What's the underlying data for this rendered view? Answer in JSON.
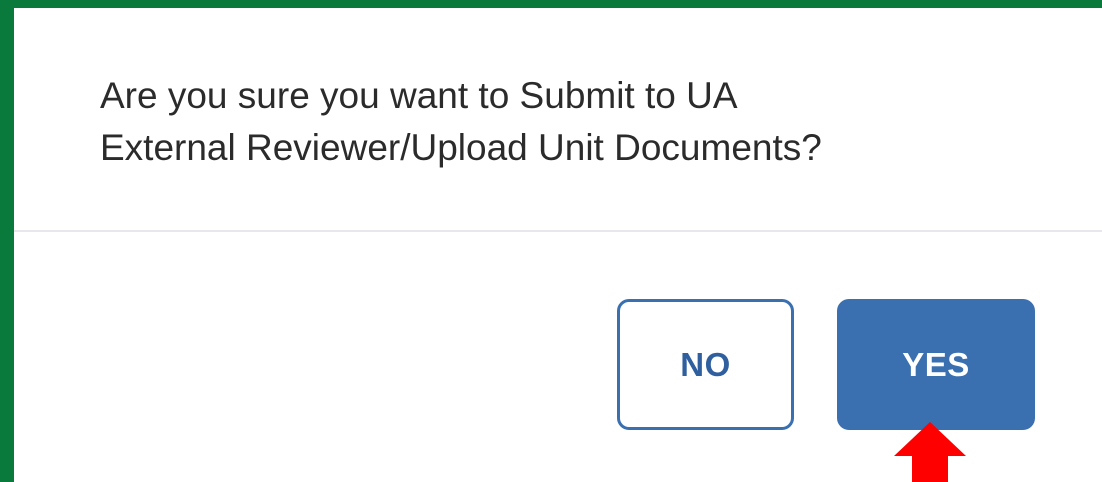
{
  "dialog": {
    "message_line1": "Are you sure you want to Submit to UA",
    "message_line2": "External Reviewer/Upload Unit Documents?",
    "no_label": "NO",
    "yes_label": "YES"
  },
  "annotation": {
    "arrow_icon": "red-up-arrow-icon",
    "arrow_color": "#ff0000"
  },
  "colors": {
    "frame_border": "#0a7a3c",
    "button_primary": "#3a6fb0",
    "button_outline": "#3a6fb0"
  }
}
